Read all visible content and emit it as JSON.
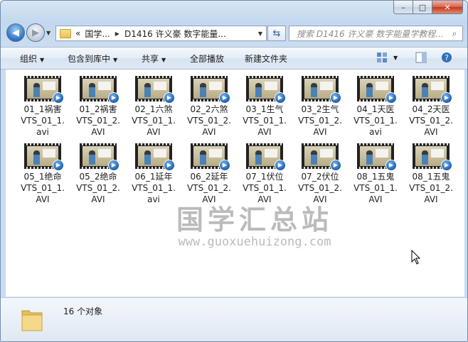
{
  "window": {
    "caption_buttons": {
      "minimize": "–",
      "maximize": "□",
      "close": "✕"
    }
  },
  "nav": {
    "back_icon": "back-arrow-icon",
    "forward_icon": "forward-arrow-icon"
  },
  "address": {
    "chevron": "«",
    "segments": [
      "国学...",
      "D1416 许义豪 数字能量..."
    ]
  },
  "search": {
    "placeholder": "搜索 D1416 许义豪 数字能量学教程..."
  },
  "toolbar": {
    "organize": "组织",
    "include_library": "包含到库中",
    "share": "共享",
    "play_all": "全部播放",
    "new_folder": "新建文件夹"
  },
  "files": [
    {
      "line1": "01_1祸害",
      "line2": "VTS_01_1.",
      "line3": "avi"
    },
    {
      "line1": "01_2祸害",
      "line2": "VTS_01_2.",
      "line3": "AVI"
    },
    {
      "line1": "02_1六煞",
      "line2": "VTS_01_1.",
      "line3": "AVI"
    },
    {
      "line1": "02_2六煞",
      "line2": "VTS_01_2.",
      "line3": "AVI"
    },
    {
      "line1": "03_1生气",
      "line2": "VTS_01_1.",
      "line3": "AVI"
    },
    {
      "line1": "03_2生气",
      "line2": "VTS_01_2.",
      "line3": "AVI"
    },
    {
      "line1": "04_1天医",
      "line2": "VTS_01_1.",
      "line3": "avi"
    },
    {
      "line1": "04_2天医",
      "line2": "VTS_01_2.",
      "line3": "AVI"
    },
    {
      "line1": "05_1绝命",
      "line2": "VTS_01_1.",
      "line3": "AVI"
    },
    {
      "line1": "05_2绝命",
      "line2": "VTS_01_2.",
      "line3": "AVI"
    },
    {
      "line1": "06_1延年",
      "line2": "VTS_01_1.",
      "line3": "avi"
    },
    {
      "line1": "06_2延年",
      "line2": "VTS_01_2.",
      "line3": "AVI"
    },
    {
      "line1": "07_1伏位",
      "line2": "VTS_01_1.",
      "line3": "AVI"
    },
    {
      "line1": "07_2伏位",
      "line2": "VTS_01_2.",
      "line3": "AVI"
    },
    {
      "line1": "08_1五鬼",
      "line2": "VTS_01_1.",
      "line3": "AVI"
    },
    {
      "line1": "08_1五鬼",
      "line2": "VTS_01_2.",
      "line3": "AVI"
    }
  ],
  "watermark": {
    "line1": "国学汇总站",
    "line2": "www.guoxuehuizong.com"
  },
  "status": {
    "count": "16 个对象"
  },
  "colors": {
    "accent": "#2f6fbf",
    "close": "#c4361d"
  }
}
